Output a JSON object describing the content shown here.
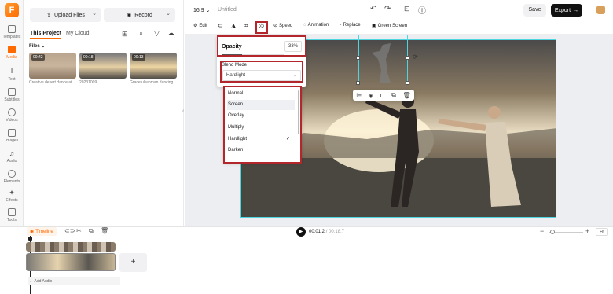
{
  "nav": {
    "logo": "F",
    "items": [
      "Templates",
      "Media",
      "Text",
      "Subtitles",
      "Videos",
      "Images",
      "Audio",
      "Elements",
      "Effects",
      "Tools"
    ]
  },
  "media": {
    "upload_label": "Upload Files",
    "record_label": "Record",
    "tab_project": "This Project",
    "tab_cloud": "My Cloud",
    "files_label": "Files",
    "files": [
      {
        "duration": "00:42",
        "name": "Creative desert dance at..."
      },
      {
        "duration": "00:18",
        "name": "20231009"
      },
      {
        "duration": "00:13",
        "name": "Graceful woman dancing ..."
      }
    ]
  },
  "topbar": {
    "ratio": "16:9",
    "title": "Untitled",
    "save": "Save",
    "export": "Export"
  },
  "toolbar": {
    "edit": "Edit",
    "speed": "Speed",
    "animation": "Animation",
    "replace": "Replace",
    "green_screen": "Green Screen"
  },
  "opacity": {
    "label": "Opacity",
    "value": "33%",
    "fraction": 0.33,
    "blend_label": "Blend Mode",
    "blend_value": "Hardlight"
  },
  "blend_options": [
    {
      "label": "Normal",
      "checked": false,
      "hover": false
    },
    {
      "label": "Screen",
      "checked": false,
      "hover": true
    },
    {
      "label": "Overlay",
      "checked": false,
      "hover": false
    },
    {
      "label": "Multiply",
      "checked": false,
      "hover": false
    },
    {
      "label": "Hardlight",
      "checked": true,
      "hover": false
    },
    {
      "label": "Darken",
      "checked": false,
      "hover": false
    }
  ],
  "timeline": {
    "label": "Timeline",
    "current": "00:01:2",
    "total": "00:18:7",
    "fit": "Fit",
    "add_audio": "Add Audio"
  },
  "colors": {
    "accent": "#ff6a00",
    "highlight_box": "#b3262b",
    "selection": "#4dd6e0"
  }
}
